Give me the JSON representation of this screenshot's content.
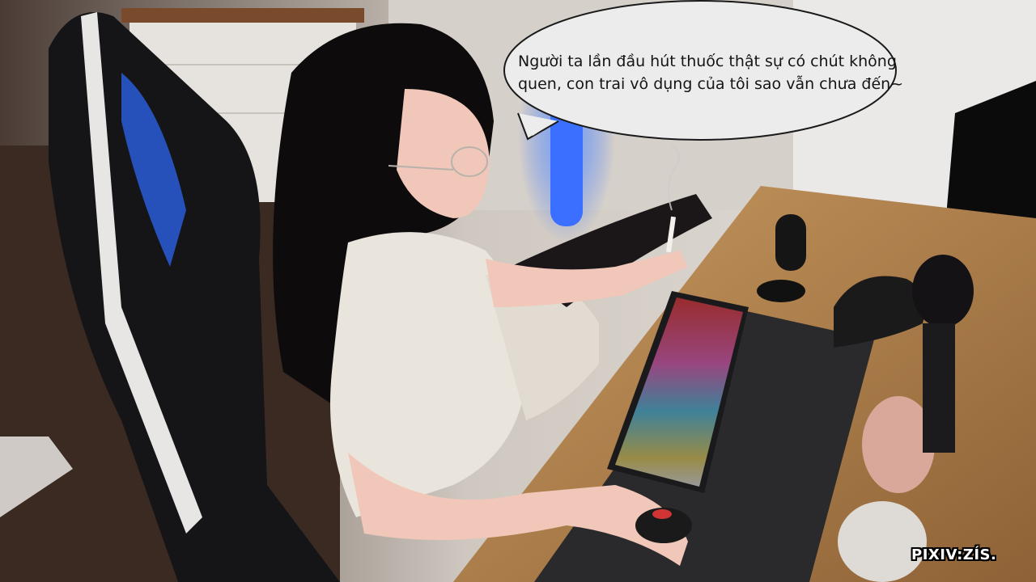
{
  "speech_bubble": {
    "lines": [
      "Người ta lần đầu hút thuốc thật sự có chút không",
      "quen, con trai vô dụng của tôi sao vẫn chưa đến~"
    ]
  },
  "watermark": "PIXIV:ZÍS.",
  "colors": {
    "wall": "#d9d4ce",
    "floor": "#3a2a22",
    "desk": "#b98650",
    "mousepad": "#2a2a2c",
    "chair": "#151518",
    "chair_trim": "#e8e6e4",
    "accent_blue": "#2f6bff",
    "dress": "#e9e4dc",
    "hair": "#0d0b0c",
    "skin": "#f0c7b8"
  }
}
